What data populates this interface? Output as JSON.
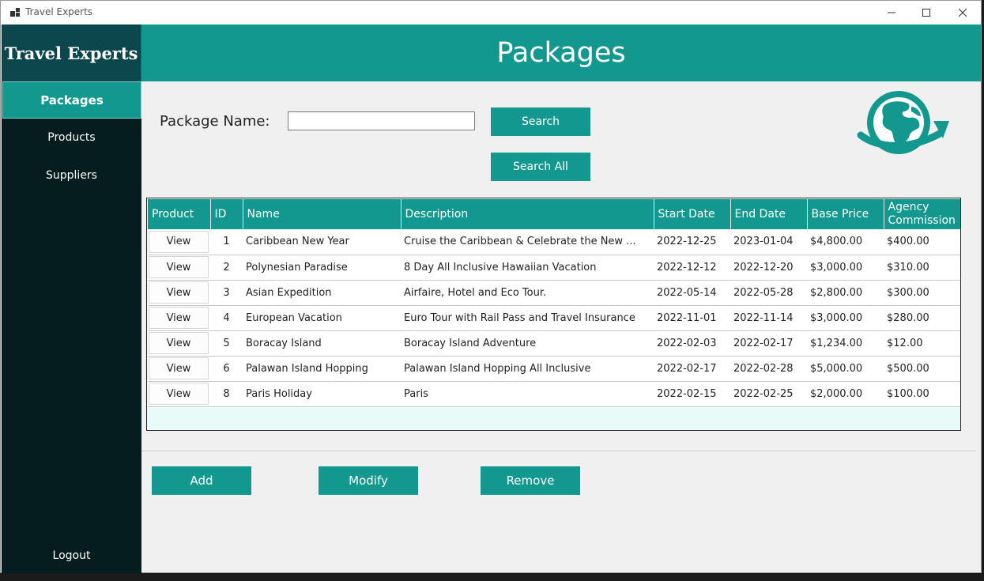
{
  "window": {
    "title": "Travel Experts"
  },
  "sidebar": {
    "brand": "Travel Experts",
    "items": [
      {
        "label": "Packages",
        "active": true
      },
      {
        "label": "Products"
      },
      {
        "label": "Suppliers"
      }
    ],
    "logout": "Logout"
  },
  "header": {
    "title": "Packages"
  },
  "search": {
    "label": "Package Name:",
    "value": "",
    "placeholder": "",
    "search_button": "Search",
    "search_all_button": "Search All"
  },
  "table": {
    "columns": [
      "Product",
      "ID",
      "Name",
      "Description",
      "Start Date",
      "End Date",
      "Base Price",
      "Agency Commission"
    ],
    "view_label": "View",
    "rows": [
      {
        "id": "1",
        "name": "Caribbean New Year",
        "description": "Cruise the Caribbean & Celebrate the New ...",
        "start": "2022-12-25",
        "end": "2023-01-04",
        "price": "$4,800.00",
        "commission": "$400.00"
      },
      {
        "id": "2",
        "name": "Polynesian Paradise",
        "description": "8 Day All Inclusive Hawaiian Vacation",
        "start": "2022-12-12",
        "end": "2022-12-20",
        "price": "$3,000.00",
        "commission": "$310.00"
      },
      {
        "id": "3",
        "name": "Asian Expedition",
        "description": "Airfaire, Hotel and Eco Tour.",
        "start": "2022-05-14",
        "end": "2022-05-28",
        "price": "$2,800.00",
        "commission": "$300.00"
      },
      {
        "id": "4",
        "name": "European Vacation",
        "description": "Euro Tour with Rail Pass and Travel Insurance",
        "start": "2022-11-01",
        "end": "2022-11-14",
        "price": "$3,000.00",
        "commission": "$280.00"
      },
      {
        "id": "5",
        "name": "Boracay Island",
        "description": "Boracay Island Adventure",
        "start": "2022-02-03",
        "end": "2022-02-17",
        "price": "$1,234.00",
        "commission": "$12.00"
      },
      {
        "id": "6",
        "name": "Palawan Island Hopping",
        "description": "Palawan Island Hopping All Inclusive",
        "start": "2022-02-17",
        "end": "2022-02-28",
        "price": "$5,000.00",
        "commission": "$500.00"
      },
      {
        "id": "8",
        "name": "Paris Holiday",
        "description": "Paris",
        "start": "2022-02-15",
        "end": "2022-02-25",
        "price": "$2,000.00",
        "commission": "$100.00"
      }
    ]
  },
  "actions": {
    "add": "Add",
    "modify": "Modify",
    "remove": "Remove"
  },
  "icons": {
    "app": "app-window-icon",
    "globe": "globe-icon",
    "minimize": "minimize-icon",
    "maximize": "maximize-icon",
    "close": "close-icon"
  },
  "colors": {
    "teal": "#139890",
    "sidebar": "#061d1f",
    "brand_bg": "#0c474d"
  }
}
